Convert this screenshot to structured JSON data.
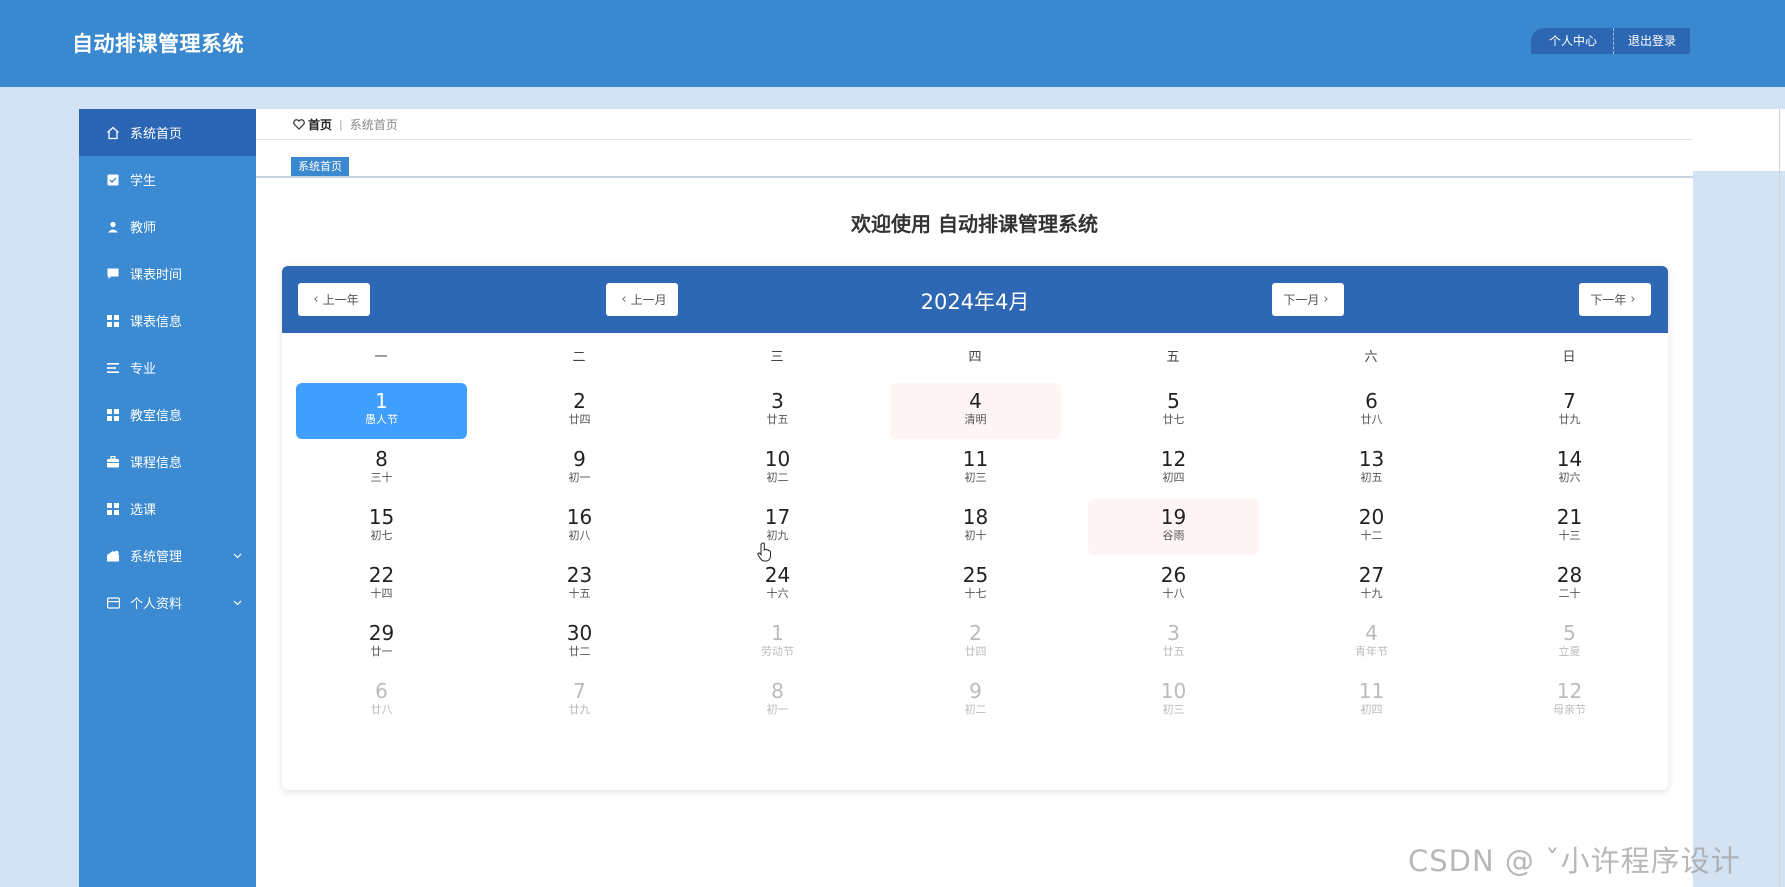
{
  "header": {
    "title": "自动排课管理系统",
    "personal_center": "个人中心",
    "logout": "退出登录"
  },
  "sidebar": {
    "items": [
      {
        "label": "系统首页",
        "icon": "home-icon"
      },
      {
        "label": "学生",
        "icon": "checkbox-icon"
      },
      {
        "label": "教师",
        "icon": "user-icon"
      },
      {
        "label": "课表时间",
        "icon": "chat-icon"
      },
      {
        "label": "课表信息",
        "icon": "grid-icon"
      },
      {
        "label": "专业",
        "icon": "list-icon"
      },
      {
        "label": "教室信息",
        "icon": "grid-icon"
      },
      {
        "label": "课程信息",
        "icon": "briefcase-icon"
      },
      {
        "label": "选课",
        "icon": "grid-icon"
      },
      {
        "label": "系统管理",
        "icon": "settings-icon"
      },
      {
        "label": "个人资料",
        "icon": "card-icon"
      }
    ]
  },
  "breadcrumb": {
    "home": "首页",
    "separator": "|",
    "current": "系统首页"
  },
  "tabs": [
    {
      "label": "系统首页"
    }
  ],
  "welcome": "欢迎使用 自动排课管理系统",
  "calendar": {
    "prev_year": "上一年",
    "prev_month": "上一月",
    "month_title": "2024年4月",
    "next_month": "下一月",
    "next_year": "下一年",
    "weekdays": [
      "一",
      "二",
      "三",
      "四",
      "五",
      "六",
      "日"
    ],
    "days": [
      {
        "d": "1",
        "l": "愚人节",
        "s": "today"
      },
      {
        "d": "2",
        "l": "廿四"
      },
      {
        "d": "3",
        "l": "廿五"
      },
      {
        "d": "4",
        "l": "清明",
        "s": "holiday"
      },
      {
        "d": "5",
        "l": "廿七"
      },
      {
        "d": "6",
        "l": "廿八"
      },
      {
        "d": "7",
        "l": "廿九"
      },
      {
        "d": "8",
        "l": "三十"
      },
      {
        "d": "9",
        "l": "初一"
      },
      {
        "d": "10",
        "l": "初二"
      },
      {
        "d": "11",
        "l": "初三"
      },
      {
        "d": "12",
        "l": "初四"
      },
      {
        "d": "13",
        "l": "初五"
      },
      {
        "d": "14",
        "l": "初六"
      },
      {
        "d": "15",
        "l": "初七"
      },
      {
        "d": "16",
        "l": "初八"
      },
      {
        "d": "17",
        "l": "初九"
      },
      {
        "d": "18",
        "l": "初十"
      },
      {
        "d": "19",
        "l": "谷雨",
        "s": "holiday"
      },
      {
        "d": "20",
        "l": "十二"
      },
      {
        "d": "21",
        "l": "十三"
      },
      {
        "d": "22",
        "l": "十四"
      },
      {
        "d": "23",
        "l": "十五"
      },
      {
        "d": "24",
        "l": "十六"
      },
      {
        "d": "25",
        "l": "十七"
      },
      {
        "d": "26",
        "l": "十八"
      },
      {
        "d": "27",
        "l": "十九"
      },
      {
        "d": "28",
        "l": "二十"
      },
      {
        "d": "29",
        "l": "廿一"
      },
      {
        "d": "30",
        "l": "廿二"
      },
      {
        "d": "1",
        "l": "劳动节",
        "s": "other"
      },
      {
        "d": "2",
        "l": "廿四",
        "s": "other"
      },
      {
        "d": "3",
        "l": "廿五",
        "s": "other"
      },
      {
        "d": "4",
        "l": "青年节",
        "s": "other"
      },
      {
        "d": "5",
        "l": "立夏",
        "s": "other"
      },
      {
        "d": "6",
        "l": "廿八",
        "s": "other"
      },
      {
        "d": "7",
        "l": "廿九",
        "s": "other"
      },
      {
        "d": "8",
        "l": "初一",
        "s": "other"
      },
      {
        "d": "9",
        "l": "初二",
        "s": "other"
      },
      {
        "d": "10",
        "l": "初三",
        "s": "other"
      },
      {
        "d": "11",
        "l": "初四",
        "s": "other"
      },
      {
        "d": "12",
        "l": "母亲节",
        "s": "other"
      }
    ]
  },
  "watermark": "CSDN @ ˇ小许程序设计",
  "colors": {
    "header": "#3a89d0",
    "sidebar": "#3b8ad2",
    "sidebar_active": "#2a66b4",
    "calendar_header": "#2e67b4",
    "today": "#409eff",
    "holiday": "#fff5f4"
  }
}
